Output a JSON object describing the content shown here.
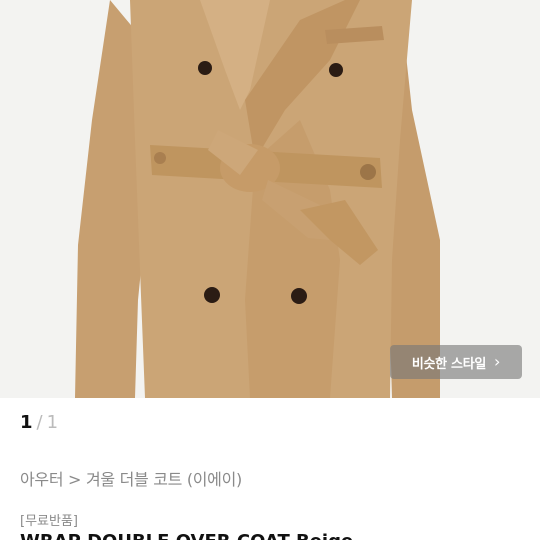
{
  "similar_style_button": {
    "label": "비슷한 스타일",
    "icon": "chevron-right-icon"
  },
  "pager": {
    "current": "1",
    "separator": "/",
    "total": "1"
  },
  "breadcrumb": "아우터 > 겨울 더블 코트 (이에이)",
  "tag": "[무료반품]",
  "product_title": "WRAP DOUBLE OVER COAT Beige",
  "colors": {
    "coat": "#c9a273",
    "background": "#f3f3f1"
  }
}
